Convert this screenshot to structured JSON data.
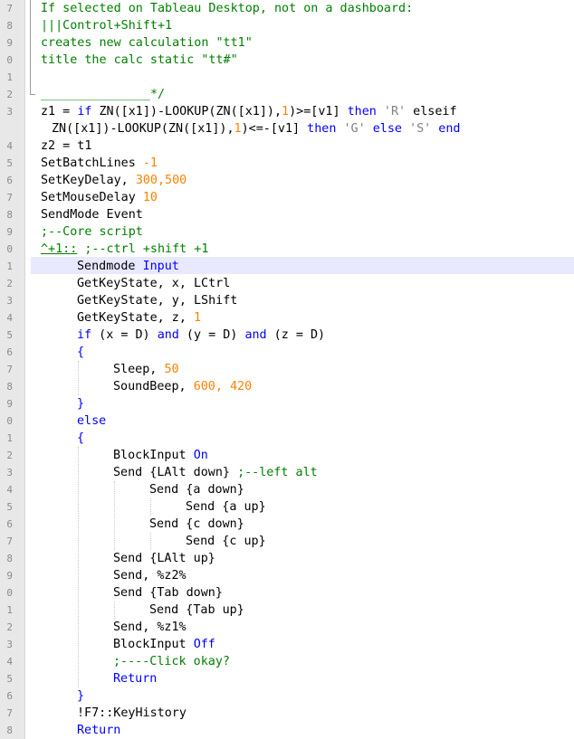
{
  "gutter": {
    "line_numbers": [
      "7",
      "8",
      "9",
      "0",
      "1",
      "2",
      "3",
      "",
      "4",
      "5",
      "6",
      "7",
      "8",
      "9",
      "0",
      "1",
      "2",
      "3",
      "4",
      "5",
      "6",
      "7",
      "8",
      "9",
      "0",
      "1",
      "2",
      "3",
      "4",
      "5",
      "6",
      "7",
      "8",
      "9",
      "0",
      "1",
      "2",
      "3",
      "4",
      "5",
      "6",
      "7",
      "8"
    ]
  },
  "code": {
    "l7": "If selected on Tableau Desktop, not on a dashboard:",
    "l8": "|||Control+Shift+1",
    "l9": "creates new calculation \"tt1\"",
    "l10": "title the calc static \"tt#\"",
    "l12_underscores": "_______________",
    "l12_close": "*/",
    "l13_a": "z1 = ",
    "l13_if": "if",
    "l13_b": " ZN([x1])-LOOKUP(ZN([x1]),",
    "l13_one": "1",
    "l13_c": ")>=[v1] ",
    "l13_then": "then",
    "l13_sp": " ",
    "l13_R": "'R'",
    "l13_elseif": " elseif",
    "l13w_a": "ZN([x1])-LOOKUP(ZN([x1]),",
    "l13w_one": "1",
    "l13w_b": ")<=-[v1] ",
    "l13w_then": "then",
    "l13w_sp": " ",
    "l13w_G": "'G'",
    "l13w_sp2": " ",
    "l13w_else": "else",
    "l13w_sp3": " ",
    "l13w_S": "'S'",
    "l13w_sp4": " ",
    "l13w_end": "end",
    "l14": "z2 = t1",
    "l15_a": "SetBatchLines ",
    "l15_n": "-1",
    "l16_a": "SetKeyDelay, ",
    "l16_n": "300,500",
    "l17_a": "SetMouseDelay ",
    "l17_n": "10",
    "l18": "SendMode Event",
    "l19": ";--Core script",
    "l20_hk": "^+1::",
    "l20_c": " ;--ctrl +shift +1",
    "l21_a": "Sendmode ",
    "l21_k": "Input",
    "l22": "GetKeyState, x, LCtrl",
    "l23": "GetKeyState, y, LShift",
    "l24_a": "GetKeyState, z, ",
    "l24_n": "1",
    "l25_if": "if",
    "l25_a": " (x = D) ",
    "l25_and1": "and",
    "l25_b": " (y = D) ",
    "l25_and2": "and",
    "l25_c": " (z = D)",
    "l26": "{",
    "l27_a": "Sleep, ",
    "l27_n": "50",
    "l28_a": "SoundBeep, ",
    "l28_n": "600, 420",
    "l29": "}",
    "l30": "else",
    "l31": "{",
    "l32_a": "BlockInput ",
    "l32_k": "On",
    "l33_a": "Send {LAlt down} ",
    "l33_c": ";--left alt",
    "l34": "Send {a down}",
    "l35": "Send {a up}",
    "l36": "Send {c down}",
    "l37": "Send {c up}",
    "l38": "Send {LAlt up}",
    "l39": "Send, %z2%",
    "l40": "Send {Tab down}",
    "l41": "Send {Tab up}",
    "l42": "Send, %z1%",
    "l43_a": "BlockInput ",
    "l43_k": "Off",
    "l44": ";----Click okay?",
    "l45": "Return",
    "l46": "}",
    "l47": "!F7::KeyHistory",
    "l48": "Return"
  },
  "colors": {
    "keyword": "#0000ff",
    "number": "#ff8000",
    "string": "#808080",
    "comment": "#008000",
    "current_line": "#e8e8ff",
    "gutter": "#e8e8e8"
  }
}
